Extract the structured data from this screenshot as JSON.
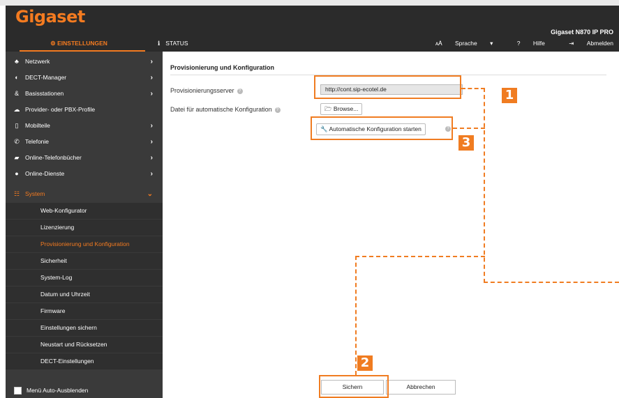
{
  "header": {
    "logo": "Gigaset",
    "device": "Gigaset N870 IP PRO"
  },
  "nav": {
    "settings_tab": "EINSTELLUNGEN",
    "status_tab": "STATUS",
    "language": "Sprache",
    "help": "Hilfe",
    "logout": "Abmelden"
  },
  "sidebar": {
    "items": [
      {
        "label": "Netzwerk",
        "icon": "network-icon"
      },
      {
        "label": "DECT-Manager",
        "icon": "dect-manager-icon"
      },
      {
        "label": "Basisstationen",
        "icon": "base-stations-icon"
      },
      {
        "label": "Provider- oder PBX-Profile",
        "icon": "cloud-icon"
      },
      {
        "label": "Mobilteile",
        "icon": "handset-icon"
      },
      {
        "label": "Telefonie",
        "icon": "phone-icon"
      },
      {
        "label": "Online-Telefonbücher",
        "icon": "book-icon"
      },
      {
        "label": "Online-Dienste",
        "icon": "globe-icon"
      },
      {
        "label": "System",
        "icon": "system-icon"
      }
    ],
    "subitems": [
      "Web-Konfigurator",
      "Lizenzierung",
      "Provisionierung und Konfiguration",
      "Sicherheit",
      "System-Log",
      "Datum und Uhrzeit",
      "Firmware",
      "Einstellungen sichern",
      "Neustart und Rücksetzen",
      "DECT-Einstellungen"
    ],
    "autohide": "Menü Auto-Ausblenden"
  },
  "main": {
    "title": "Provisionierung und Konfiguration",
    "server_label": "Provisionierungsserver",
    "server_value": "http://cont.sip-ecotel.de",
    "file_label": "Datei für automatische Konfiguration",
    "browse": "Browse...",
    "auto_config": "Automatische Konfiguration starten",
    "save": "Sichern",
    "cancel": "Abbrechen"
  },
  "callouts": [
    "1",
    "2",
    "3"
  ],
  "colors": {
    "accent": "#f47b20",
    "callout": "#f07c21",
    "header_bg": "#2b2b2b",
    "sidebar_bg": "#3a3a3a"
  }
}
